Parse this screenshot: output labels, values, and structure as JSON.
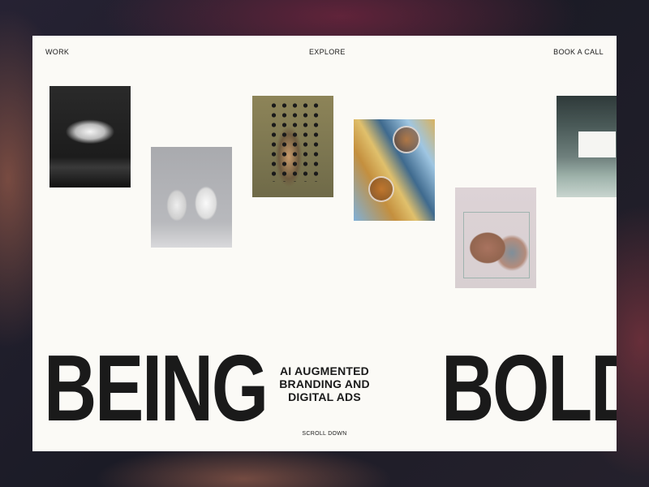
{
  "nav": {
    "work": "WORK",
    "explore": "EXPLORE",
    "book_call": "BOOK A CALL"
  },
  "hero": {
    "left_word": "BEING",
    "right_word": "BOLD",
    "tagline_lines": [
      "AI AUGMENTED",
      "BRANDING AND",
      "DIGITAL ADS"
    ],
    "scroll_label": "SCROLL DOWN"
  },
  "gallery": [
    {
      "name": "floating-fabric-photo"
    },
    {
      "name": "gummy-bears-photo"
    },
    {
      "name": "perforated-panel-photo"
    },
    {
      "name": "cocktail-glasses-photo"
    },
    {
      "name": "stones-in-glass-case-photo"
    },
    {
      "name": "street-billboard-photo"
    }
  ],
  "colors": {
    "background": "#1d1d27",
    "card": "#fbfaf6",
    "text": "#1a1a1a"
  }
}
